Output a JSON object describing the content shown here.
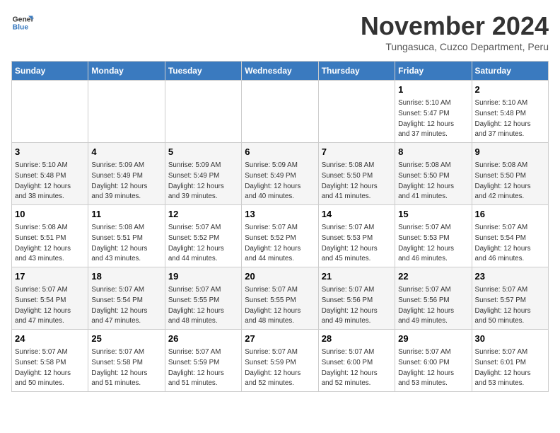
{
  "header": {
    "logo_line1": "General",
    "logo_line2": "Blue",
    "month_year": "November 2024",
    "location": "Tungasuca, Cuzco Department, Peru"
  },
  "days_of_week": [
    "Sunday",
    "Monday",
    "Tuesday",
    "Wednesday",
    "Thursday",
    "Friday",
    "Saturday"
  ],
  "weeks": [
    [
      {
        "day": "",
        "info": ""
      },
      {
        "day": "",
        "info": ""
      },
      {
        "day": "",
        "info": ""
      },
      {
        "day": "",
        "info": ""
      },
      {
        "day": "",
        "info": ""
      },
      {
        "day": "1",
        "info": "Sunrise: 5:10 AM\nSunset: 5:47 PM\nDaylight: 12 hours\nand 37 minutes."
      },
      {
        "day": "2",
        "info": "Sunrise: 5:10 AM\nSunset: 5:48 PM\nDaylight: 12 hours\nand 37 minutes."
      }
    ],
    [
      {
        "day": "3",
        "info": "Sunrise: 5:10 AM\nSunset: 5:48 PM\nDaylight: 12 hours\nand 38 minutes."
      },
      {
        "day": "4",
        "info": "Sunrise: 5:09 AM\nSunset: 5:49 PM\nDaylight: 12 hours\nand 39 minutes."
      },
      {
        "day": "5",
        "info": "Sunrise: 5:09 AM\nSunset: 5:49 PM\nDaylight: 12 hours\nand 39 minutes."
      },
      {
        "day": "6",
        "info": "Sunrise: 5:09 AM\nSunset: 5:49 PM\nDaylight: 12 hours\nand 40 minutes."
      },
      {
        "day": "7",
        "info": "Sunrise: 5:08 AM\nSunset: 5:50 PM\nDaylight: 12 hours\nand 41 minutes."
      },
      {
        "day": "8",
        "info": "Sunrise: 5:08 AM\nSunset: 5:50 PM\nDaylight: 12 hours\nand 41 minutes."
      },
      {
        "day": "9",
        "info": "Sunrise: 5:08 AM\nSunset: 5:50 PM\nDaylight: 12 hours\nand 42 minutes."
      }
    ],
    [
      {
        "day": "10",
        "info": "Sunrise: 5:08 AM\nSunset: 5:51 PM\nDaylight: 12 hours\nand 43 minutes."
      },
      {
        "day": "11",
        "info": "Sunrise: 5:08 AM\nSunset: 5:51 PM\nDaylight: 12 hours\nand 43 minutes."
      },
      {
        "day": "12",
        "info": "Sunrise: 5:07 AM\nSunset: 5:52 PM\nDaylight: 12 hours\nand 44 minutes."
      },
      {
        "day": "13",
        "info": "Sunrise: 5:07 AM\nSunset: 5:52 PM\nDaylight: 12 hours\nand 44 minutes."
      },
      {
        "day": "14",
        "info": "Sunrise: 5:07 AM\nSunset: 5:53 PM\nDaylight: 12 hours\nand 45 minutes."
      },
      {
        "day": "15",
        "info": "Sunrise: 5:07 AM\nSunset: 5:53 PM\nDaylight: 12 hours\nand 46 minutes."
      },
      {
        "day": "16",
        "info": "Sunrise: 5:07 AM\nSunset: 5:54 PM\nDaylight: 12 hours\nand 46 minutes."
      }
    ],
    [
      {
        "day": "17",
        "info": "Sunrise: 5:07 AM\nSunset: 5:54 PM\nDaylight: 12 hours\nand 47 minutes."
      },
      {
        "day": "18",
        "info": "Sunrise: 5:07 AM\nSunset: 5:54 PM\nDaylight: 12 hours\nand 47 minutes."
      },
      {
        "day": "19",
        "info": "Sunrise: 5:07 AM\nSunset: 5:55 PM\nDaylight: 12 hours\nand 48 minutes."
      },
      {
        "day": "20",
        "info": "Sunrise: 5:07 AM\nSunset: 5:55 PM\nDaylight: 12 hours\nand 48 minutes."
      },
      {
        "day": "21",
        "info": "Sunrise: 5:07 AM\nSunset: 5:56 PM\nDaylight: 12 hours\nand 49 minutes."
      },
      {
        "day": "22",
        "info": "Sunrise: 5:07 AM\nSunset: 5:56 PM\nDaylight: 12 hours\nand 49 minutes."
      },
      {
        "day": "23",
        "info": "Sunrise: 5:07 AM\nSunset: 5:57 PM\nDaylight: 12 hours\nand 50 minutes."
      }
    ],
    [
      {
        "day": "24",
        "info": "Sunrise: 5:07 AM\nSunset: 5:58 PM\nDaylight: 12 hours\nand 50 minutes."
      },
      {
        "day": "25",
        "info": "Sunrise: 5:07 AM\nSunset: 5:58 PM\nDaylight: 12 hours\nand 51 minutes."
      },
      {
        "day": "26",
        "info": "Sunrise: 5:07 AM\nSunset: 5:59 PM\nDaylight: 12 hours\nand 51 minutes."
      },
      {
        "day": "27",
        "info": "Sunrise: 5:07 AM\nSunset: 5:59 PM\nDaylight: 12 hours\nand 52 minutes."
      },
      {
        "day": "28",
        "info": "Sunrise: 5:07 AM\nSunset: 6:00 PM\nDaylight: 12 hours\nand 52 minutes."
      },
      {
        "day": "29",
        "info": "Sunrise: 5:07 AM\nSunset: 6:00 PM\nDaylight: 12 hours\nand 53 minutes."
      },
      {
        "day": "30",
        "info": "Sunrise: 5:07 AM\nSunset: 6:01 PM\nDaylight: 12 hours\nand 53 minutes."
      }
    ]
  ]
}
